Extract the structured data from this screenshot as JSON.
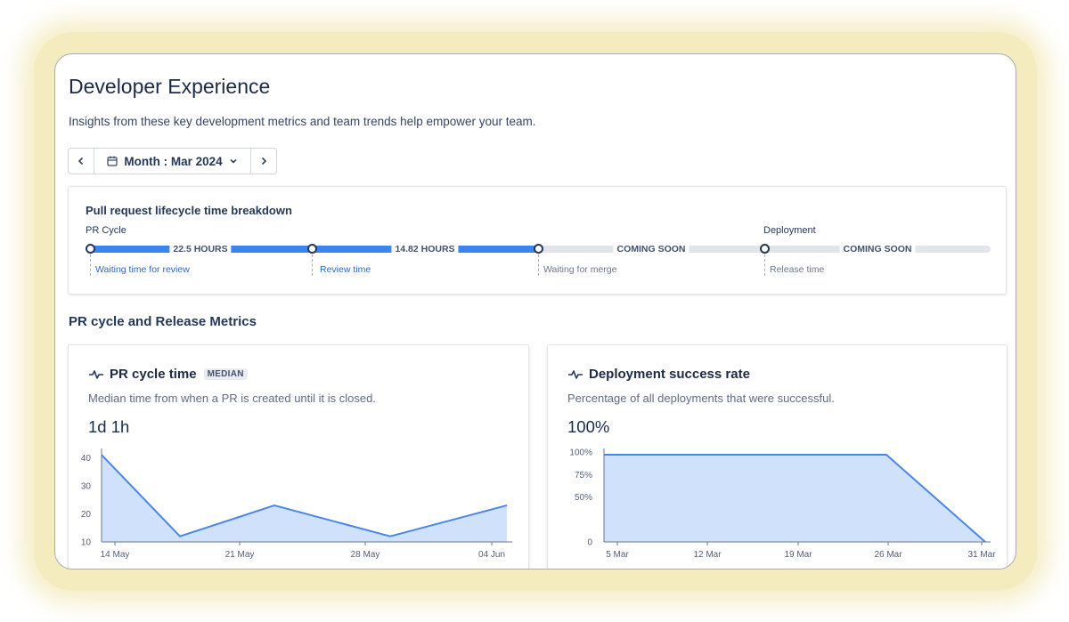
{
  "page": {
    "title": "Developer Experience",
    "subtitle": "Insights from these key development metrics and team trends help empower your team."
  },
  "period": {
    "prev_icon": "chevron-left-icon",
    "calendar_icon": "calendar-icon",
    "label": "Month : Mar 2024",
    "dropdown_icon": "chevron-down-icon",
    "next_icon": "chevron-right-icon"
  },
  "lifecycle": {
    "title": "Pull request lifecycle time breakdown",
    "groups": {
      "pr": "PR Cycle",
      "deployment": "Deployment"
    },
    "stages": [
      {
        "duration": "22.5 HOURS",
        "label": "Waiting time for review"
      },
      {
        "duration": "14.82 HOURS",
        "label": "Review time"
      },
      {
        "duration": "COMING SOON",
        "label": "Waiting for merge"
      },
      {
        "duration": "COMING SOON",
        "label": "Release time"
      }
    ],
    "colors": {
      "active": "#3c84f0",
      "inactive": "#e2e5e9"
    }
  },
  "section": {
    "title": "PR cycle and Release Metrics"
  },
  "pr_cycle": {
    "icon": "pulse-icon",
    "title": "PR cycle time",
    "badge": "MEDIAN",
    "description": "Median time from when a PR is created until it is closed.",
    "value": "1d 1h"
  },
  "deploy": {
    "icon": "pulse-icon",
    "title": "Deployment success rate",
    "description": "Percentage of all deployments that were successful.",
    "value": "100%"
  },
  "chart_data": [
    {
      "type": "area",
      "x": [
        "14 May",
        "18 May",
        "23 May",
        "30 May",
        "04 Jun"
      ],
      "values": [
        41,
        12,
        23,
        12,
        23
      ],
      "xticks": [
        "14 May",
        "21 May",
        "28 May",
        "04 Jun"
      ],
      "yticks": [
        "10",
        "20",
        "30",
        "40"
      ],
      "ylim": [
        10,
        42
      ],
      "grid": false,
      "color": "#4a86e8",
      "fill": "#cfe1fb"
    },
    {
      "type": "area",
      "x": [
        "5 Mar",
        "26 Mar",
        "31 Mar"
      ],
      "values": [
        97,
        97,
        0
      ],
      "xticks": [
        "5 Mar",
        "12 Mar",
        "19 Mar",
        "26 Mar",
        "31 Mar"
      ],
      "yticks": [
        "0",
        "50%",
        "75%",
        "100%"
      ],
      "ylim": [
        0,
        100
      ],
      "grid": false,
      "color": "#4a86e8",
      "fill": "#cfe1fb"
    }
  ]
}
